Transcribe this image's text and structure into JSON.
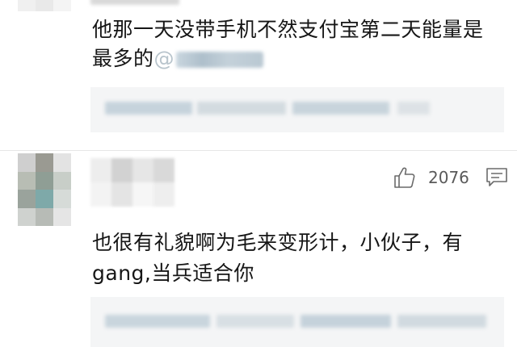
{
  "comments": [
    {
      "text_lines": [
        "他那一天没带手机不然支付宝第二天能量是",
        "最多的"
      ],
      "mention_prefix": "@"
    },
    {
      "like_count": "2076",
      "text_lines": [
        "也很有礼貌啊为毛来变形计，小伙子，有",
        "gang,当兵适合你"
      ]
    }
  ],
  "icons": {
    "like": "thumbs-up-icon",
    "reply": "comment-bubble-icon"
  },
  "colors": {
    "text": "#161616",
    "secondary": "#5a5a5a",
    "reply_bg": "#f4f5f6",
    "divider": "#e7e7e7"
  }
}
